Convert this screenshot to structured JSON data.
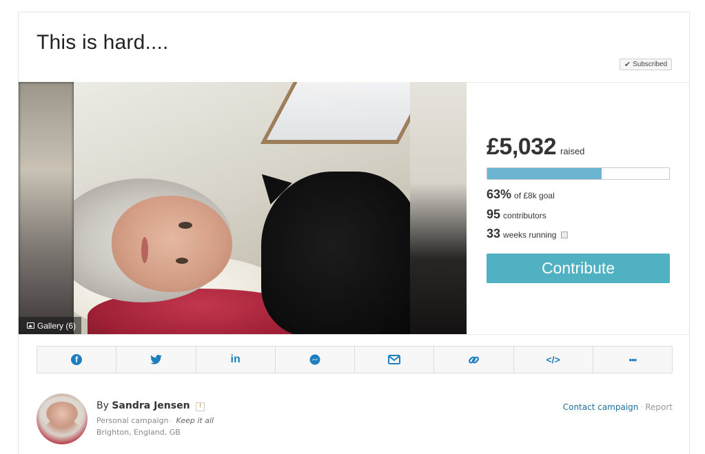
{
  "campaign": {
    "title": "This is hard....",
    "subscribed_label": "Subscribed"
  },
  "gallery": {
    "label": "Gallery (6)"
  },
  "stats": {
    "amount": "£5,032",
    "raised_label": "raised",
    "progress_fraction": 0.63,
    "percent": "63%",
    "goal_label": "of £8k goal",
    "contributors_count": "95",
    "contributors_label": "contributors",
    "weeks_count": "33",
    "weeks_label": "weeks running",
    "contribute_label": "Contribute"
  },
  "share": {
    "items": [
      {
        "name": "facebook-icon",
        "glyph": "f"
      },
      {
        "name": "twitter-icon",
        "glyph": "🐦"
      },
      {
        "name": "linkedin-icon",
        "glyph": "in"
      },
      {
        "name": "messenger-icon",
        "glyph": "≈"
      },
      {
        "name": "email-icon",
        "glyph": ""
      },
      {
        "name": "link-icon",
        "glyph": "🔗"
      },
      {
        "name": "embed-icon",
        "glyph": "</>"
      },
      {
        "name": "more-icon",
        "glyph": "•••"
      }
    ]
  },
  "organizer": {
    "by": "By",
    "name": "Sandra Jensen",
    "flag": "!",
    "campaign_type": "Personal campaign",
    "funding_model": "Keep it all",
    "location": "Brighton, England, GB",
    "contact_label": "Contact campaign",
    "report_label": "Report"
  },
  "colors": {
    "accent": "#4fb1c1",
    "progress": "#6cb5d1",
    "share_icon": "#1f7fbe"
  }
}
